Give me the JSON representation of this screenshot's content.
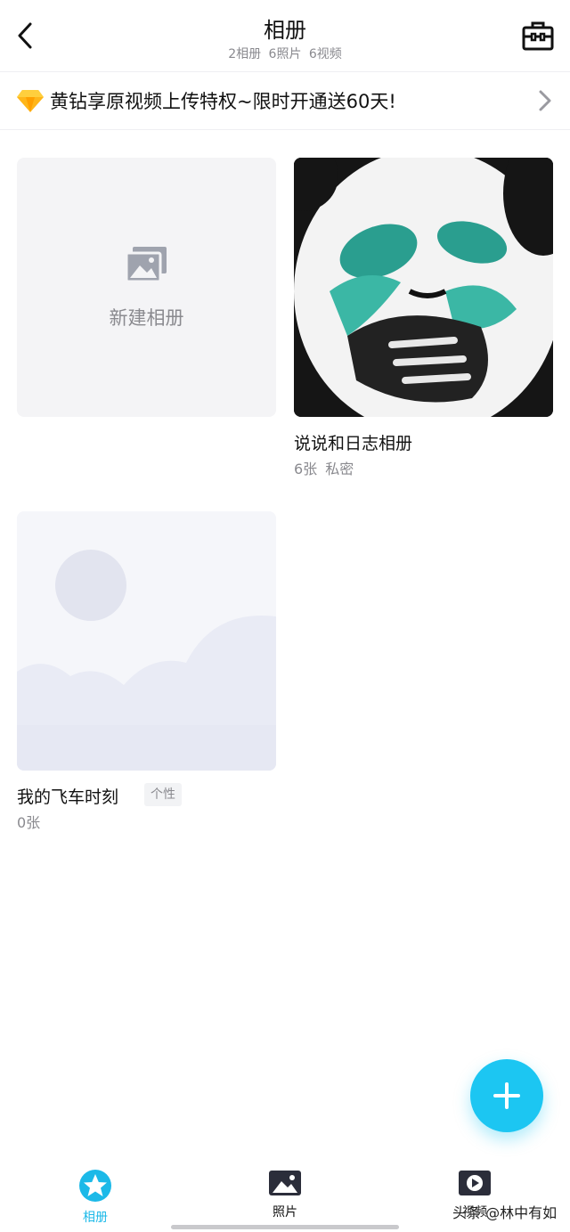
{
  "header": {
    "title": "相册",
    "subtitle": "2相册 6照片 6视频"
  },
  "promo": {
    "text": "黄钻享原视频上传特权~限时开通送60天!"
  },
  "new_album": {
    "label": "新建相册"
  },
  "albums": [
    {
      "name": "说说和日志相册",
      "meta": "6张 私密"
    },
    {
      "name": "我的飞车时刻",
      "tag": "个性",
      "meta": "0张"
    }
  ],
  "tabs": [
    {
      "label": "相册",
      "active": true
    },
    {
      "label": "照片",
      "active": false
    },
    {
      "label": "视频",
      "active": false
    }
  ],
  "watermark": "头条 @林中有如",
  "colors": {
    "accent": "#1cc6f2",
    "active_tab": "#1cb9e8",
    "muted_text": "#8a8a8f"
  }
}
